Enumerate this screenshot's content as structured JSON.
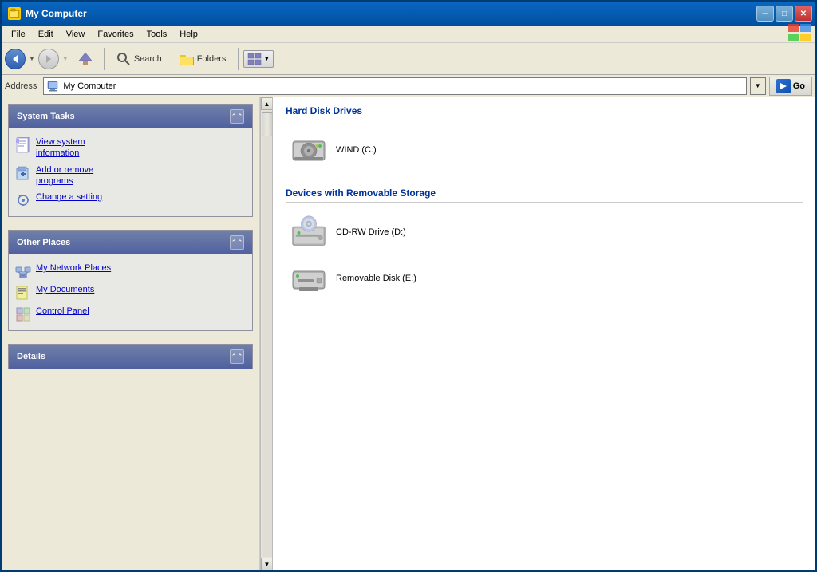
{
  "window": {
    "title": "My Computer",
    "title_icon": "💻"
  },
  "titlebar_buttons": {
    "minimize": "─",
    "maximize": "□",
    "close": "✕"
  },
  "menubar": {
    "items": [
      {
        "label": "File"
      },
      {
        "label": "Edit"
      },
      {
        "label": "View"
      },
      {
        "label": "Favorites"
      },
      {
        "label": "Tools"
      },
      {
        "label": "Help"
      }
    ]
  },
  "toolbar": {
    "back_label": "Back",
    "forward_label": "",
    "up_label": "",
    "search_label": "Search",
    "folders_label": "Folders",
    "views_label": "⊞"
  },
  "address_bar": {
    "label": "Address",
    "value": "My Computer",
    "go_label": "Go"
  },
  "system_tasks": {
    "header": "System Tasks",
    "items": [
      {
        "label": "View system\ninformation",
        "icon": "📋"
      },
      {
        "label": "Add or remove\nprograms",
        "icon": "📦"
      },
      {
        "label": "Change a setting",
        "icon": "🔧"
      }
    ]
  },
  "other_places": {
    "header": "Other Places",
    "items": [
      {
        "label": "My Network Places",
        "icon": "🌐"
      },
      {
        "label": "My Documents",
        "icon": "📁"
      },
      {
        "label": "Control Panel",
        "icon": "🖥"
      }
    ]
  },
  "details": {
    "header": "Details"
  },
  "hard_disk_section": {
    "title": "Hard Disk Drives",
    "drives": [
      {
        "label": "WIND (C:)",
        "type": "hdd"
      }
    ]
  },
  "removable_section": {
    "title": "Devices with Removable Storage",
    "drives": [
      {
        "label": "CD-RW Drive (D:)",
        "type": "cdrom"
      },
      {
        "label": "Removable Disk (E:)",
        "type": "removable"
      }
    ]
  }
}
